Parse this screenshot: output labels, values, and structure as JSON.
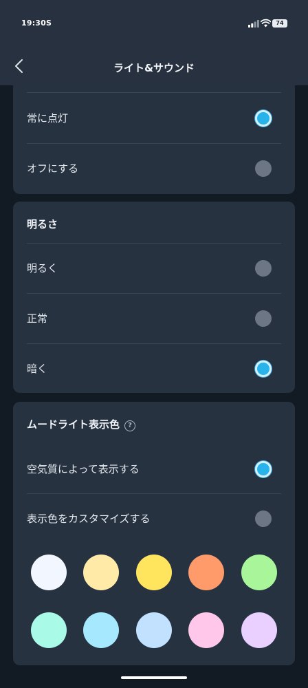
{
  "status_bar": {
    "time": "19:30",
    "carrier_indicator": "S",
    "battery_level": "74",
    "icons": [
      "signal-icon",
      "wifi-icon",
      "battery-icon"
    ]
  },
  "header": {
    "title": "ライト&サウンド",
    "back_icon": "chevron-left-icon"
  },
  "card_display": {
    "options": [
      {
        "label": "常に点灯",
        "selected": true
      },
      {
        "label": "オフにする",
        "selected": false
      }
    ]
  },
  "card_brightness": {
    "title": "明るさ",
    "options": [
      {
        "label": "明るく",
        "selected": false
      },
      {
        "label": "正常",
        "selected": false
      },
      {
        "label": "暗く",
        "selected": true
      }
    ]
  },
  "card_mood_light": {
    "title": "ムードライト表示色",
    "help_icon": "question-circle-icon",
    "help_glyph": "?",
    "options": [
      {
        "label": "空気質によって表示する",
        "selected": true
      },
      {
        "label": "表示色をカスタマイズする",
        "selected": false
      }
    ],
    "swatches": [
      "#f2f6ff",
      "#ffeaa8",
      "#ffe45e",
      "#ff9b6b",
      "#a8f59a",
      "#a9fbe8",
      "#a6e9ff",
      "#c2e1ff",
      "#ffc7ea",
      "#e9d0ff"
    ]
  },
  "colors": {
    "background": "#121a24",
    "card": "#273241",
    "accent": "#28b4ea",
    "radio_off": "#6c7684"
  }
}
